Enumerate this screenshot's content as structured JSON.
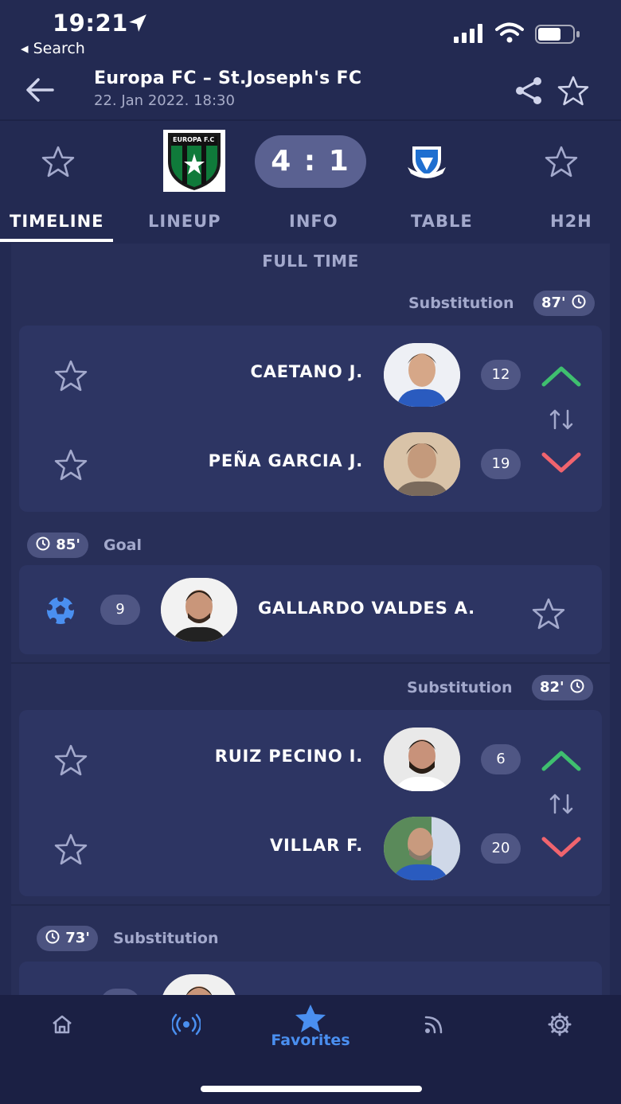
{
  "status_bar": {
    "time": "19:21",
    "back_label": "◂ Search"
  },
  "header": {
    "title": "Europa FC – St.Joseph's FC",
    "subtitle": "22. Jan 2022. 18:30"
  },
  "match": {
    "score": "4 : 1",
    "home_crest_text": "EUROPA F.C"
  },
  "tabs": [
    {
      "label": "TIMELINE",
      "active": true
    },
    {
      "label": "LINEUP",
      "active": false
    },
    {
      "label": "INFO",
      "active": false
    },
    {
      "label": "TABLE",
      "active": false
    },
    {
      "label": "H2H",
      "active": false
    }
  ],
  "timeline": {
    "period_label": "FULL TIME",
    "events": [
      {
        "type": "Substitution",
        "minute": "87'",
        "side": "home",
        "player_in": {
          "name": "CAETANO J.",
          "number": "12"
        },
        "player_out": {
          "name": "PEÑA GARCIA J.",
          "number": "19"
        }
      },
      {
        "type": "Goal",
        "minute": "85'",
        "side": "away",
        "player": {
          "name": "GALLARDO VALDES A.",
          "number": "9"
        }
      },
      {
        "type": "Substitution",
        "minute": "82'",
        "side": "home",
        "player_in": {
          "name": "RUIZ PECINO I.",
          "number": "6"
        },
        "player_out": {
          "name": "VILLAR F.",
          "number": "20"
        }
      },
      {
        "type": "Substitution",
        "minute": "73'",
        "side": "away"
      }
    ]
  },
  "bottom_nav": {
    "active_label": "Favorites",
    "items": [
      "home-icon",
      "live-icon",
      "favorites-icon",
      "news-icon",
      "settings-icon"
    ]
  },
  "colors": {
    "background": "#232a52",
    "card": "#2d3563",
    "pill": "#4c5380",
    "accent_blue": "#4a8ff0",
    "arrow_up": "#3fbf6f",
    "arrow_down": "#f0646e"
  }
}
